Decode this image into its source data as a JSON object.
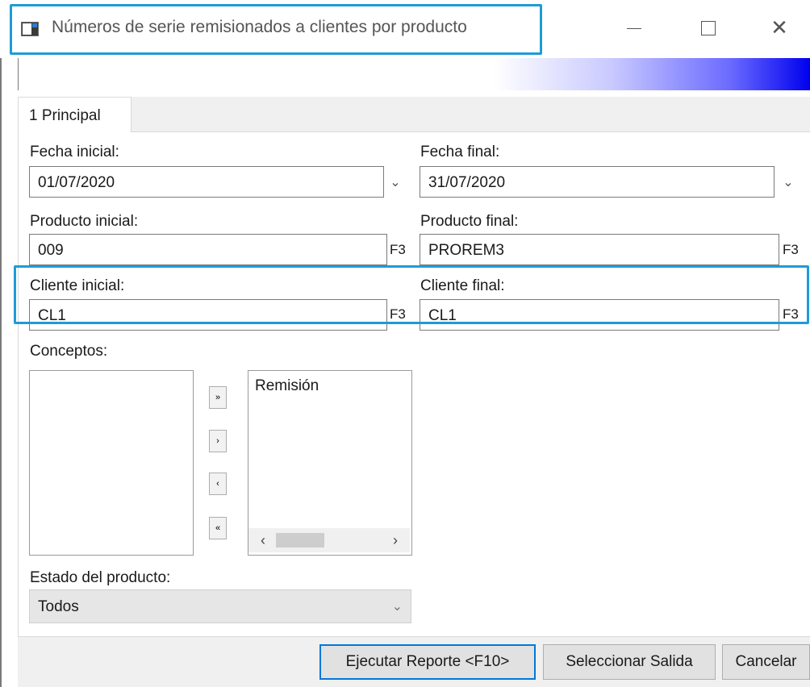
{
  "window": {
    "title": "Números de serie remisionados a clientes por producto",
    "icons": {
      "app": "app-window-icon",
      "minimize": "minimize-icon",
      "maximize": "maximize-icon",
      "close": "close-icon"
    },
    "close_glyph": "✕"
  },
  "tabs": [
    {
      "label": "1 Principal",
      "selected": true
    }
  ],
  "form": {
    "fecha_inicial": {
      "label": "Fecha inicial:",
      "value": "01/07/2020"
    },
    "fecha_final": {
      "label": "Fecha final:",
      "value": "31/07/2020"
    },
    "producto_inicial": {
      "label": "Producto inicial:",
      "value": "009",
      "lookup_key": "F3"
    },
    "producto_final": {
      "label": "Producto final:",
      "value": "PROREM3",
      "lookup_key": "F3"
    },
    "cliente_inicial": {
      "label": "Cliente inicial:",
      "value": "CL1",
      "lookup_key": "F3"
    },
    "cliente_final": {
      "label": "Cliente final:",
      "value": "CL1",
      "lookup_key": "F3"
    },
    "conceptos": {
      "label": "Conceptos:",
      "available": [],
      "selected": [
        "Remisión"
      ],
      "buttons": {
        "move_all_right": "»",
        "move_right": "›",
        "move_left": "‹",
        "move_all_left": "«"
      }
    },
    "estado_producto": {
      "label": "Estado del producto:",
      "value": "Todos"
    }
  },
  "footer": {
    "run_report": "Ejecutar Reporte <F10>",
    "select_output": "Seleccionar Salida",
    "cancel": "Cancelar"
  },
  "colors": {
    "highlight": "#1f9bd7",
    "gradient_end": "#0000ee",
    "primary_border": "#0078d7"
  }
}
